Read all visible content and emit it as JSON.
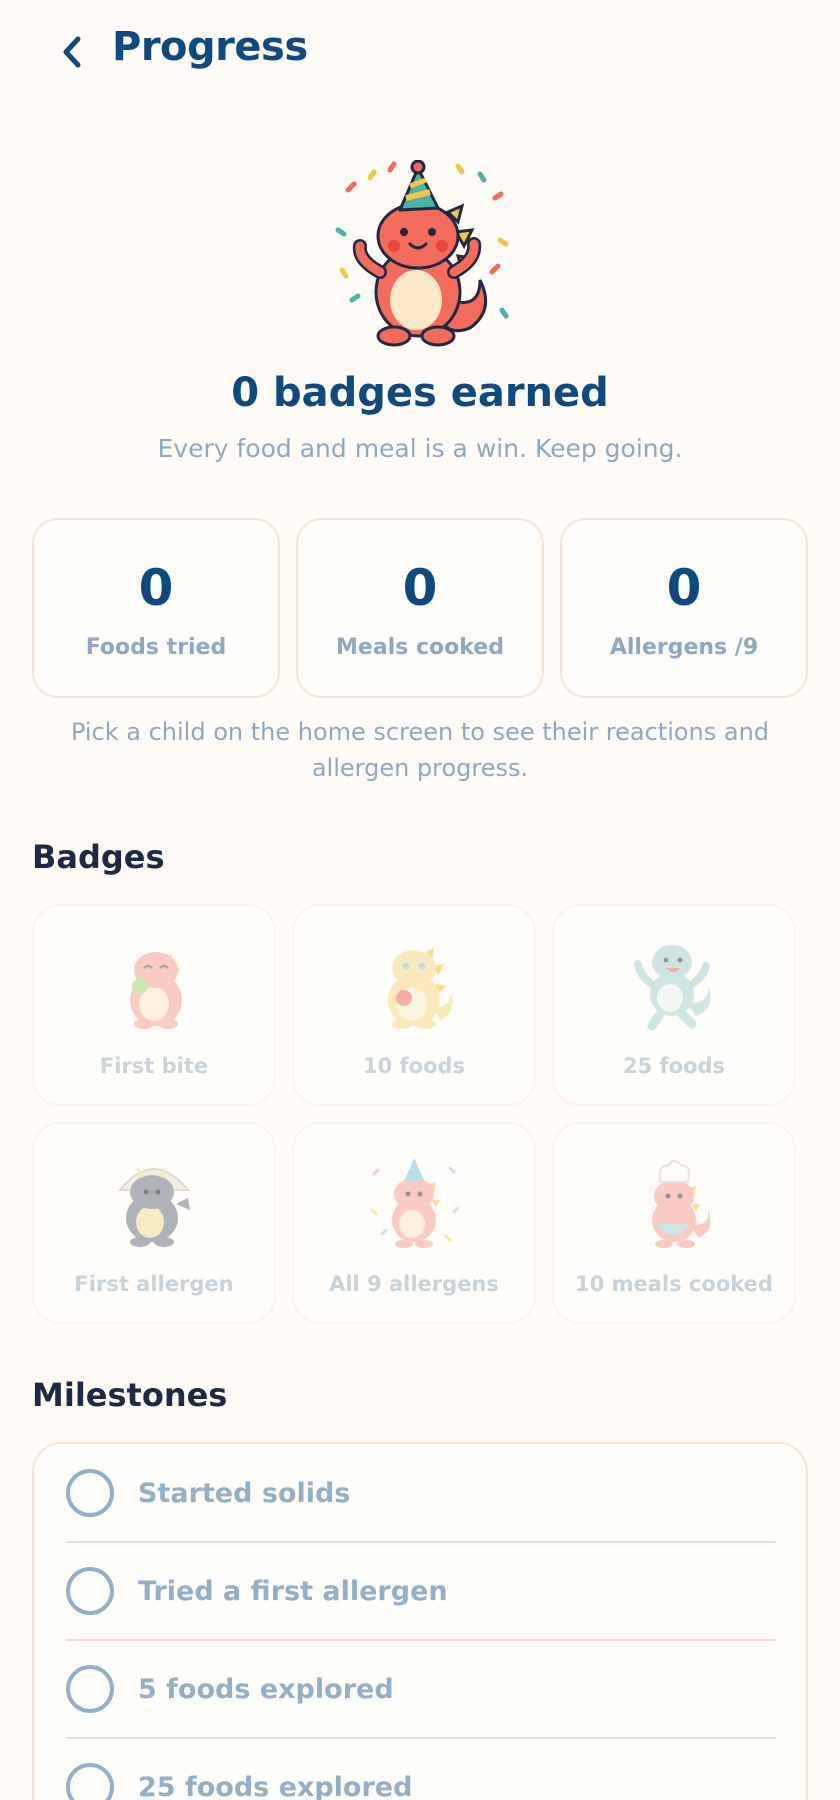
{
  "header": {
    "title": "Progress"
  },
  "summary": {
    "title": "0 badges earned",
    "subtitle": "Every food and meal is a win. Keep going."
  },
  "stats": [
    {
      "value": "0",
      "label": "Foods tried"
    },
    {
      "value": "0",
      "label": "Meals cooked"
    },
    {
      "value": "0",
      "label": "Allergens /9"
    }
  ],
  "hint": "Pick a child on the home screen to see their reactions and allergen progress.",
  "badges": {
    "title": "Badges",
    "items": [
      {
        "label": "First bite",
        "icon": "dino-eating-icon"
      },
      {
        "label": "10 foods",
        "icon": "dino-heart-eyes-icon"
      },
      {
        "label": "25 foods",
        "icon": "dino-jumping-icon"
      },
      {
        "label": "First allergen",
        "icon": "dino-triceratops-icon"
      },
      {
        "label": "All 9 allergens",
        "icon": "dino-party-icon"
      },
      {
        "label": "10 meals cooked",
        "icon": "dino-chef-icon"
      }
    ]
  },
  "milestones": {
    "title": "Milestones",
    "items": [
      {
        "label": "Started solids",
        "done": false
      },
      {
        "label": "Tried a first allergen",
        "done": false
      },
      {
        "label": "5 foods explored",
        "done": false
      },
      {
        "label": "25 foods explored",
        "done": false
      }
    ]
  },
  "colors": {
    "primary": "#0E4A7E",
    "muted": "#8FA8BF",
    "background": "#FFFCF7",
    "card_border": "#F3E5D2",
    "dino": "#F26B5B"
  }
}
